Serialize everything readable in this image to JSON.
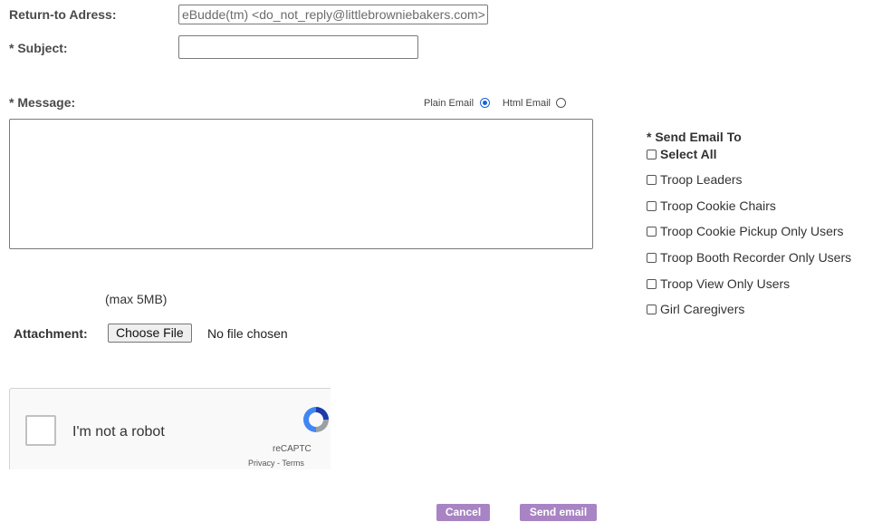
{
  "form": {
    "return_label": "Return-to Adress:",
    "return_value": "eBudde(tm) <do_not_reply@littlebrowniebakers.com>",
    "subject_label": "* Subject:",
    "subject_value": "",
    "message_label": "* Message:",
    "message_value": "",
    "plain_email_label": "Plain Email",
    "html_email_label": "Html Email",
    "email_format_selected": "Plain Email",
    "max_size_note": "(max 5MB)",
    "attachment_label": "Attachment:",
    "choose_file_label": "Choose File",
    "no_file_text": "No file chosen"
  },
  "send_to": {
    "heading": "* Send Email To",
    "select_all_label": "Select All",
    "options": [
      {
        "label": "Troop Leaders",
        "checked": false
      },
      {
        "label": "Troop Cookie Chairs",
        "checked": false
      },
      {
        "label": "Troop Cookie Pickup Only Users",
        "checked": false
      },
      {
        "label": "Troop Booth Recorder Only Users",
        "checked": false
      },
      {
        "label": "Troop View Only Users",
        "checked": false
      },
      {
        "label": "Girl Caregivers",
        "checked": false
      }
    ]
  },
  "captcha": {
    "label": "I'm not a robot",
    "brand": "reCAPTC",
    "links": "Privacy - Terms"
  },
  "actions": {
    "cancel_label": "Cancel",
    "send_label": "Send email"
  },
  "colors": {
    "button_purple": "#a884c4",
    "radio_blue": "#1a63d6"
  }
}
